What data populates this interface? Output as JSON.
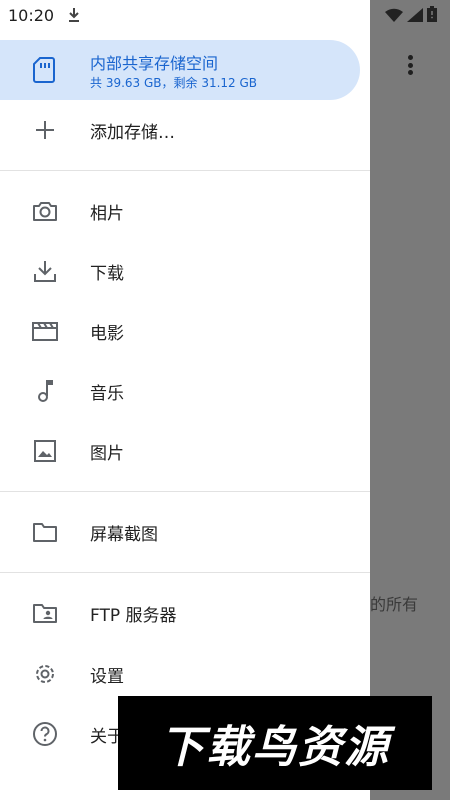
{
  "status_bar": {
    "time": "10:20"
  },
  "background": {
    "partial_text": "的所有"
  },
  "drawer": {
    "storage": {
      "title": "内部共享存储空间",
      "subtitle": "共 39.63 GB，剩余 31.12 GB"
    },
    "add_storage": "添加存储…",
    "shortcuts": [
      {
        "label": "相片",
        "icon": "camera-icon"
      },
      {
        "label": "下载",
        "icon": "download-icon"
      },
      {
        "label": "电影",
        "icon": "movie-icon"
      },
      {
        "label": "音乐",
        "icon": "music-note-icon"
      },
      {
        "label": "图片",
        "icon": "image-icon"
      }
    ],
    "screenshots": "屏幕截图",
    "ftp": "FTP 服务器",
    "settings": "设置",
    "about": "关于"
  },
  "watermark": {
    "text": "下载鸟资源"
  },
  "colors": {
    "accent": "#1a65cf",
    "selected_bg": "#d5e5fa",
    "icon": "#5f6368"
  }
}
